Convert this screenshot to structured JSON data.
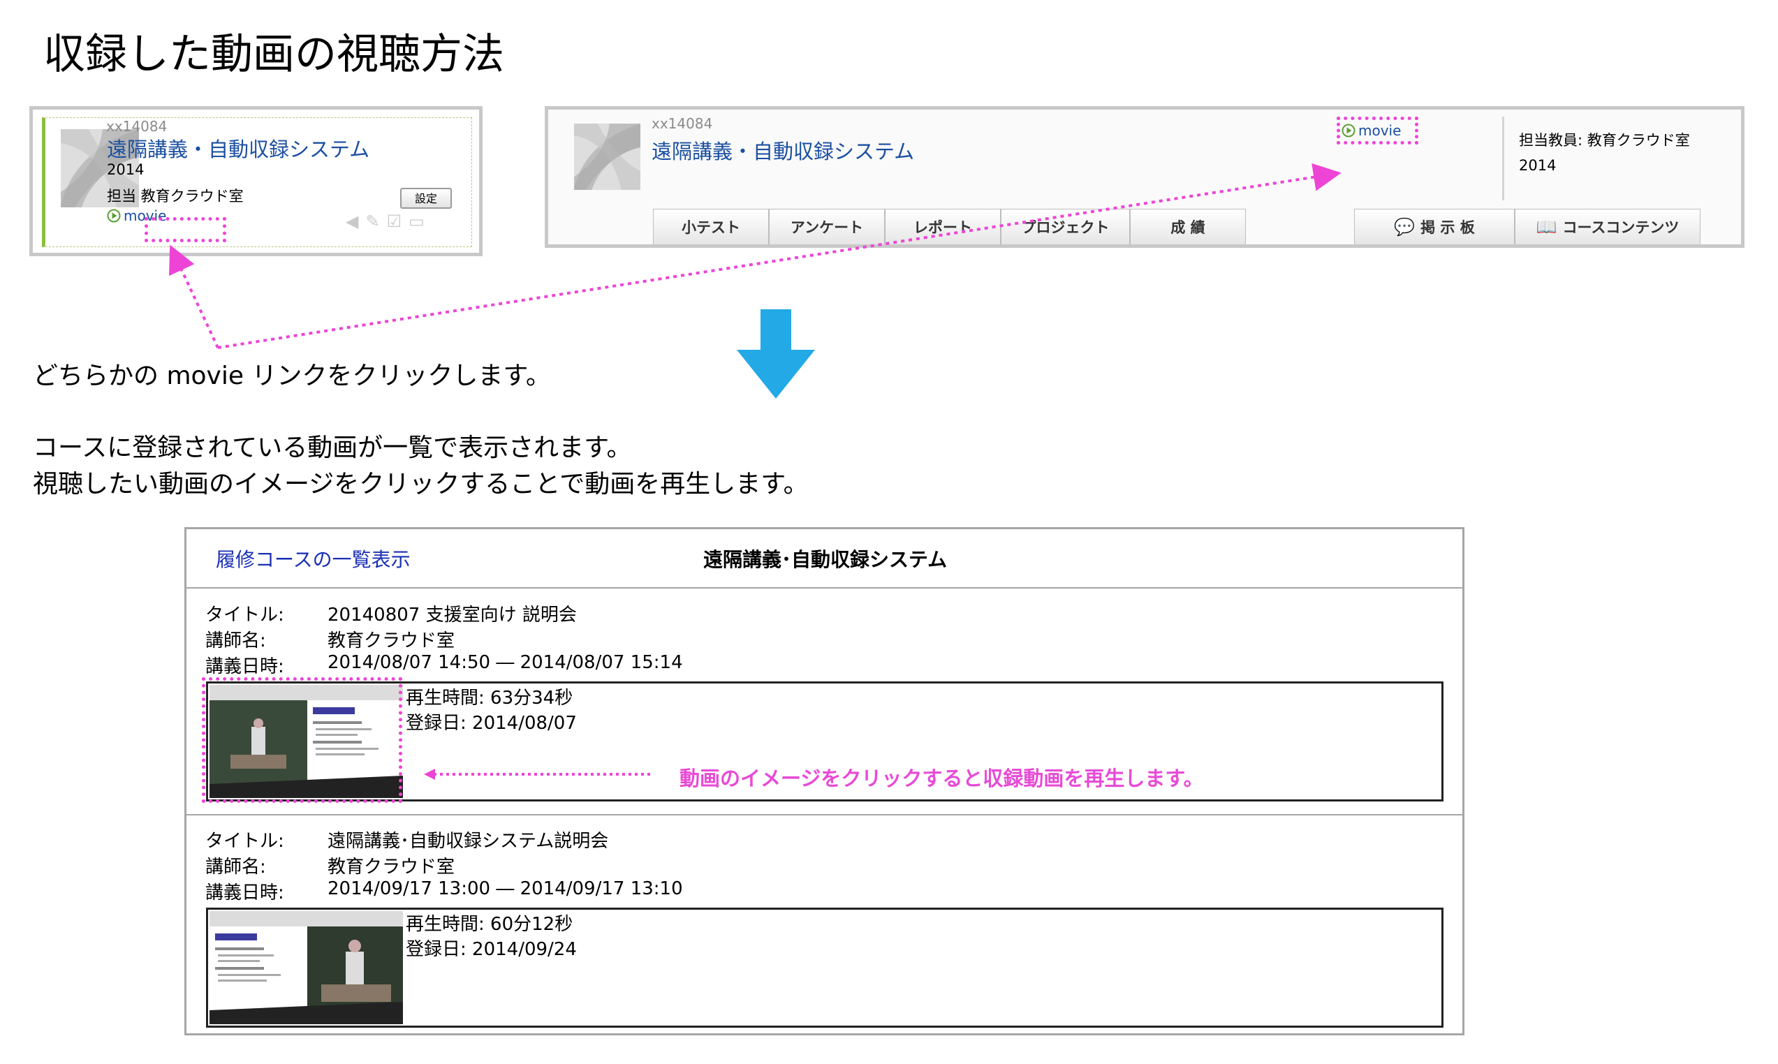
{
  "page_title": "収録した動画の視聴方法",
  "card": {
    "code": "xx14084",
    "course_name": "遠隔講義・自動収録システム",
    "year": "2014",
    "teacher": "担当 教育クラウド室",
    "settings_label": "設定",
    "movie_label": "movie"
  },
  "course_header": {
    "code": "xx14084",
    "course_name": "遠隔講義・自動収録システム",
    "movie_label": "movie",
    "teacher": "担当教員: 教育クラウド室",
    "year": "2014",
    "tabs": [
      "小テスト",
      "アンケート",
      "レポート",
      "プロジェクト",
      "成 績"
    ],
    "right_tabs": [
      "掲 示 板",
      "コースコンテンツ"
    ]
  },
  "instructions": {
    "step1": "どちらかの movie リンクをクリックします。",
    "step2_line1": "コースに登録されている動画が一覧で表示されます。",
    "step2_line2": "視聴したい動画のイメージをクリックすることで動画を再生します。"
  },
  "listing": {
    "back_link": "履修コースの一覧表示",
    "title": "遠隔講義･自動収録システム",
    "labels": {
      "title": "タイトル:",
      "lecturer": "講師名:",
      "datetime": "講義日時:"
    },
    "entries": [
      {
        "title": "20140807 支援室向け 説明会",
        "lecturer": "教育クラウド室",
        "datetime": "2014/08/07 14:50 ― 2014/08/07 15:14",
        "duration": "再生時間: 63分34秒",
        "registered": "登録日: 2014/08/07"
      },
      {
        "title": "遠隔講義･自動収録システム説明会",
        "lecturer": "教育クラウド室",
        "datetime": "2014/09/17 13:00 ― 2014/09/17 13:10",
        "duration": "再生時間: 60分12秒",
        "registered": "登録日: 2014/09/24"
      }
    ],
    "note": "動画のイメージをクリックすると収録動画を再生します。"
  },
  "colors": {
    "arrow": "#22a9e6",
    "highlight": "#ee44d6",
    "link": "#1a4fa0"
  }
}
